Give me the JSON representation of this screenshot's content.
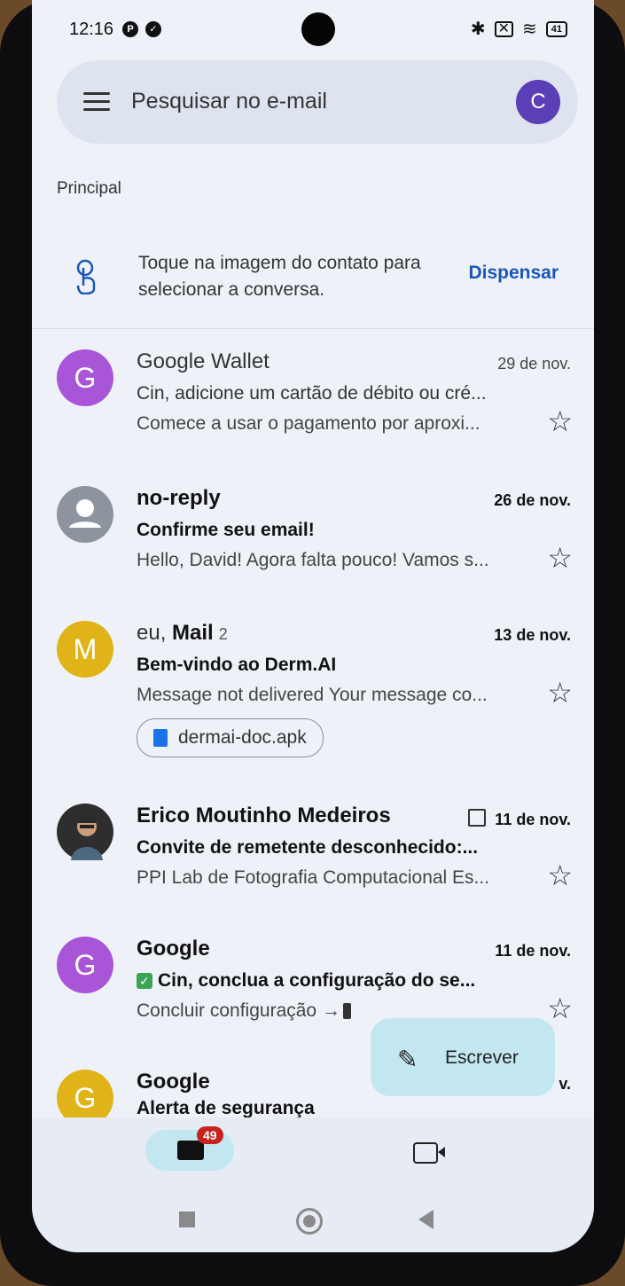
{
  "status_bar": {
    "time": "12:16",
    "battery": "41"
  },
  "search": {
    "placeholder": "Pesquisar no e-mail",
    "account_initial": "C"
  },
  "section_label": "Principal",
  "tip": {
    "text": "Toque na imagem do contato para selecionar a conversa.",
    "dismiss_label": "Dispensar"
  },
  "emails": [
    {
      "avatar": "G",
      "avatar_color": "#a855d8",
      "sender": "Google Wallet",
      "date": "29 de nov.",
      "subject": "Cin, adicione um cartão de débito ou cré...",
      "preview": "Comece a usar o pagamento por aproxi...",
      "unread": false
    },
    {
      "avatar": "person",
      "avatar_color": "#8d949e",
      "sender": "no-reply",
      "date": "26 de nov.",
      "subject": "Confirme seu email!",
      "preview": "Hello, David! Agora falta pouco! Vamos s...",
      "unread": true
    },
    {
      "avatar": "M",
      "avatar_color": "#e0b418",
      "sender_prefix": "eu, ",
      "sender": "Mail",
      "thread_count": "2",
      "date": "13 de nov.",
      "subject": "Bem-vindo ao Derm.AI",
      "preview": "Message not delivered Your message co...",
      "attachment": "dermai-doc.apk",
      "unread": true
    },
    {
      "avatar": "photo",
      "avatar_color": "#3b3b3b",
      "sender": "Erico Moutinho Medeiros",
      "date": "11 de nov.",
      "subject": "Convite de remetente desconhecido:...",
      "preview": "PPI Lab de Fotografia Computacional Es...",
      "has_calendar_icon": true,
      "unread": true
    },
    {
      "avatar": "G",
      "avatar_color": "#a855d8",
      "sender": "Google",
      "date": "11 de nov.",
      "subject": "Cin, conclua a configuração do se...",
      "preview": "Concluir configuração →",
      "unread": true
    },
    {
      "avatar": "G",
      "avatar_color": "#e0b418",
      "sender": "Google",
      "date": "v.",
      "subject": "Alerta de segurança",
      "unread": true
    }
  ],
  "compose": {
    "label": "Escrever"
  },
  "bottom_nav": {
    "mail_badge": "49"
  }
}
